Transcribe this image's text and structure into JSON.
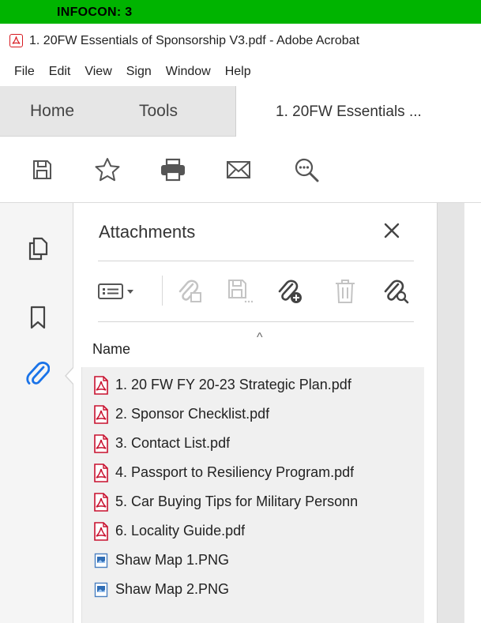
{
  "infocon": {
    "label": "INFOCON: 3",
    "color": "#00b400"
  },
  "window": {
    "title": "1. 20FW Essentials of Sponsorship V3.pdf - Adobe Acrobat",
    "icon": "acrobat-icon"
  },
  "menu": [
    "File",
    "Edit",
    "View",
    "Sign",
    "Window",
    "Help"
  ],
  "tabs": {
    "home": "Home",
    "tools": "Tools",
    "document": "1. 20FW Essentials ..."
  },
  "toolbar": {
    "icons": [
      "save-icon",
      "bookmark-star-icon",
      "print-icon",
      "email-icon",
      "zoom-search-icon"
    ]
  },
  "left_rail": {
    "icons": [
      "page-thumbnails-icon",
      "bookmarks-icon",
      "attachments-paperclip-icon"
    ],
    "active": "attachments-paperclip-icon",
    "active_color": "#1a73e8"
  },
  "attachments": {
    "title": "Attachments",
    "close_icon": "close-icon",
    "tool_icons": [
      "options-menu-icon",
      "open-attachment-icon",
      "save-attachment-icon",
      "add-attachment-icon",
      "delete-attachment-icon",
      "search-attachment-icon"
    ],
    "column_header": "Name",
    "sort_indicator": "^",
    "files": [
      {
        "name": "1. 20 FW FY 20-23 Strategic Plan.pdf",
        "type": "pdf"
      },
      {
        "name": "2. Sponsor Checklist.pdf",
        "type": "pdf"
      },
      {
        "name": "3. Contact List.pdf",
        "type": "pdf"
      },
      {
        "name": "4. Passport to Resiliency Program.pdf",
        "type": "pdf"
      },
      {
        "name": "5. Car Buying Tips for Military Personn",
        "type": "pdf"
      },
      {
        "name": "6. Locality Guide.pdf",
        "type": "pdf"
      },
      {
        "name": "Shaw Map 1.PNG",
        "type": "png"
      },
      {
        "name": "Shaw Map 2.PNG",
        "type": "png"
      }
    ]
  }
}
